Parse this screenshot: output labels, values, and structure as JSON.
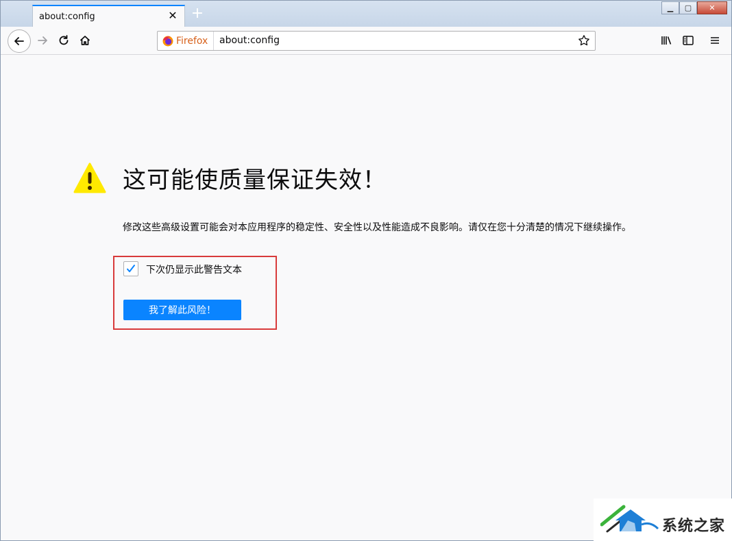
{
  "tab": {
    "title": "about:config",
    "close_label": "✕"
  },
  "new_tab_label": "+",
  "window_controls": {
    "minimize": "▁",
    "maximize": "▢",
    "close": "✕"
  },
  "urlbar": {
    "identity_label": "Firefox",
    "url": "about:config"
  },
  "warning": {
    "title": "这可能使质量保证失效！",
    "description": "修改这些高级设置可能会对本应用程序的稳定性、安全性以及性能造成不良影响。请仅在您十分清楚的情况下继续操作。",
    "checkbox_label": "下次仍显示此警告文本",
    "checkbox_checked": true,
    "accept_button": "我了解此风险！"
  },
  "watermark": {
    "text": "系统之家"
  },
  "colors": {
    "accent": "#0a84ff",
    "warning_icon": "#ffe900",
    "highlight_border": "#d83a3a",
    "firefox_label": "#d7601a"
  },
  "icons": [
    "back-arrow-icon",
    "forward-arrow-icon",
    "reload-icon",
    "home-icon",
    "firefox-logo-icon",
    "bookmark-star-icon",
    "library-icon",
    "sidebar-icon",
    "menu-icon",
    "warning-icon",
    "checkmark-icon"
  ]
}
